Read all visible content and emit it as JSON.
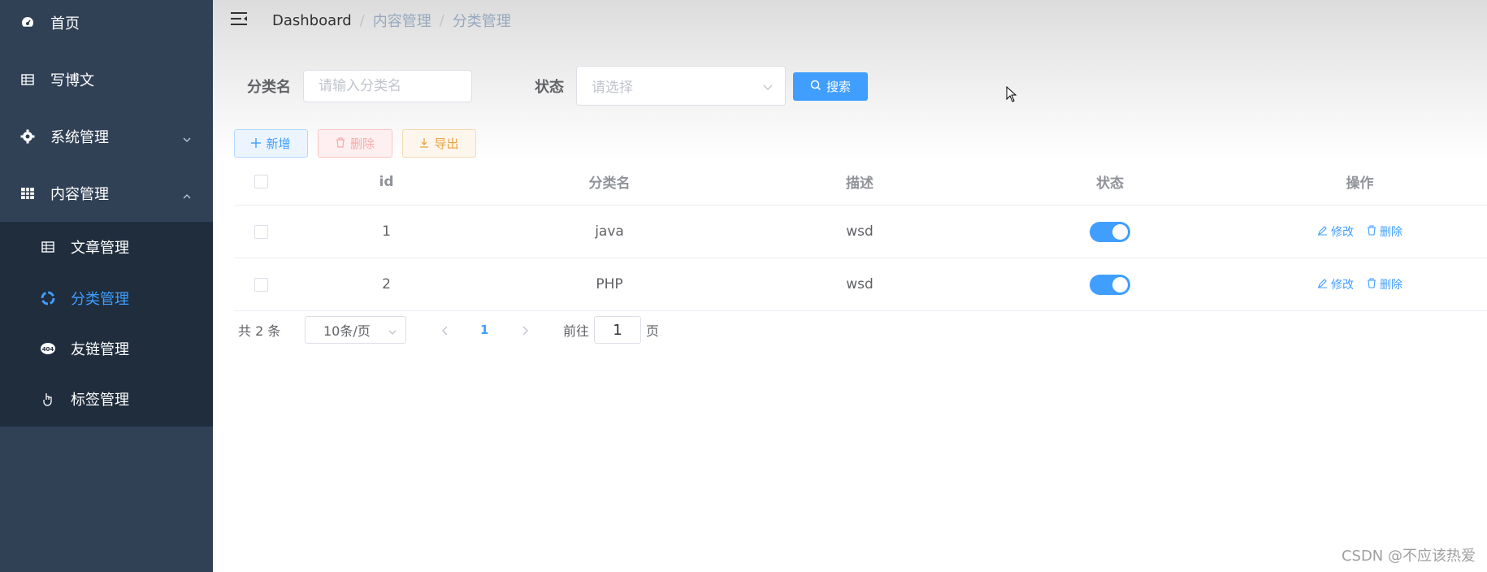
{
  "sidebar": {
    "items": [
      {
        "label": "首页",
        "icon": "dashboard-icon"
      },
      {
        "label": "写博文",
        "icon": "table-icon"
      },
      {
        "label": "系统管理",
        "icon": "gear-icon",
        "arrow": "chevron-down-icon"
      },
      {
        "label": "内容管理",
        "icon": "grid-icon",
        "arrow": "chevron-up-icon"
      }
    ],
    "sub_items": [
      {
        "label": "文章管理",
        "icon": "table-icon"
      },
      {
        "label": "分类管理",
        "icon": "category-icon",
        "active": true
      },
      {
        "label": "友链管理",
        "icon": "404-icon"
      },
      {
        "label": "标签管理",
        "icon": "hand-pointer-icon"
      }
    ]
  },
  "header": {
    "breadcrumb": [
      "Dashboard",
      "内容管理",
      "分类管理"
    ]
  },
  "filter": {
    "name_label": "分类名",
    "name_placeholder": "请输入分类名",
    "status_label": "状态",
    "status_placeholder": "请选择",
    "search_label": "搜索"
  },
  "toolbar": {
    "add_label": "新增",
    "delete_label": "删除",
    "export_label": "导出"
  },
  "table": {
    "columns": [
      "id",
      "分类名",
      "描述",
      "状态",
      "操作"
    ],
    "rows": [
      {
        "id": "1",
        "name": "java",
        "desc": "wsd",
        "status": true
      },
      {
        "id": "2",
        "name": "PHP",
        "desc": "wsd",
        "status": true
      }
    ],
    "edit_label": "修改",
    "delete_label": "删除"
  },
  "pagination": {
    "total_text": "共 2 条",
    "page_size": "10条/页",
    "current_page": "1",
    "goto_label": "前往",
    "goto_value": "1",
    "goto_unit": "页"
  },
  "watermark": "CSDN @不应该热爱",
  "colors": {
    "sidebar_bg": "#304156",
    "submenu_bg": "#1f2d3d",
    "primary": "#409eff",
    "danger_light": "#fef0f0",
    "warning": "#e6a23c"
  }
}
